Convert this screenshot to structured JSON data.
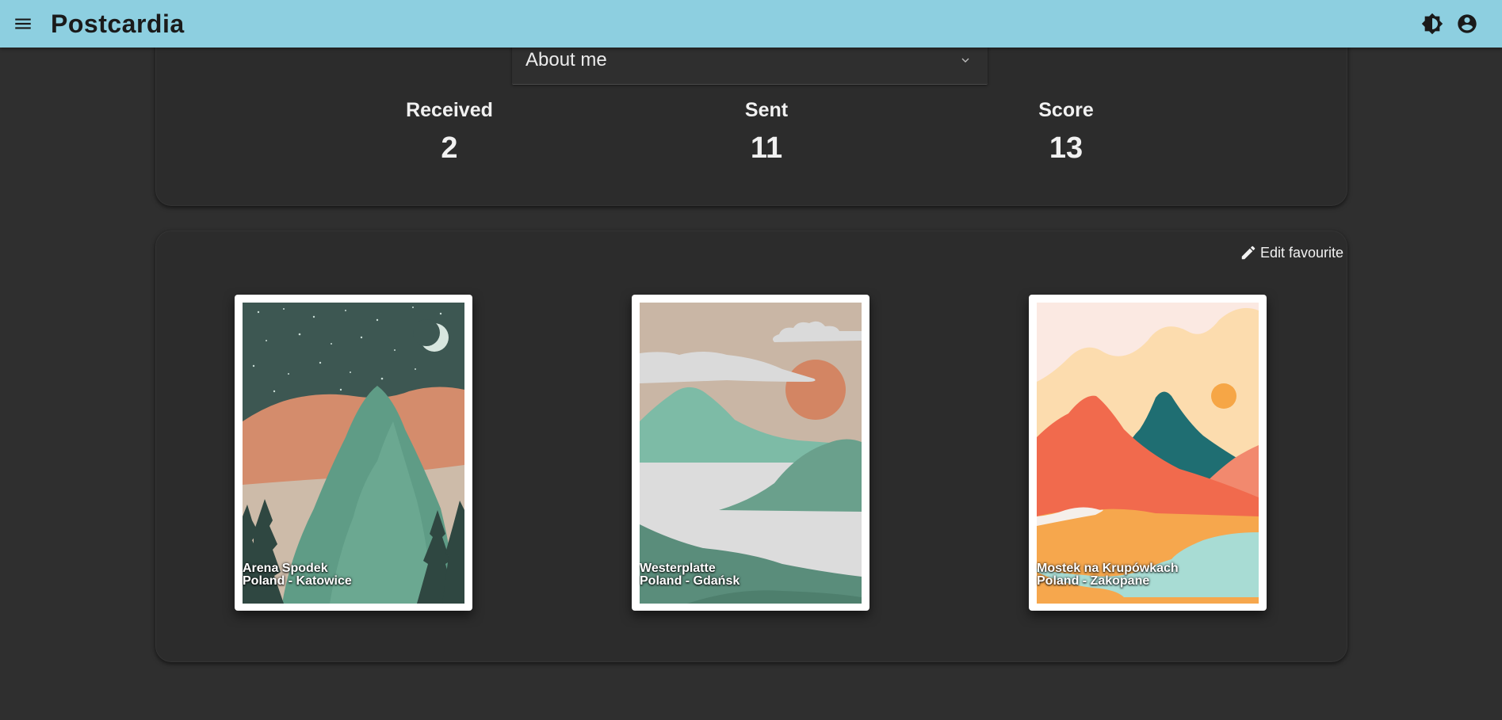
{
  "app": {
    "title": "Postcardia"
  },
  "profile": {
    "section_select": {
      "selected": "About me"
    },
    "stats": [
      {
        "label": "Received",
        "value": "2"
      },
      {
        "label": "Sent",
        "value": "11"
      },
      {
        "label": "Score",
        "value": "13"
      }
    ]
  },
  "favourites": {
    "edit_label": "Edit favourite",
    "postcards": [
      {
        "title": "Arena Spodek",
        "location": "Poland - Katowice"
      },
      {
        "title": "Westerplatte",
        "location": "Poland - Gdańsk"
      },
      {
        "title": "Mostek na Krupówkach",
        "location": "Poland - Zakopane"
      }
    ]
  },
  "colors": {
    "topbar": "#8dcfe0",
    "background": "#2f2f2f",
    "card": "#2c2c2c"
  }
}
